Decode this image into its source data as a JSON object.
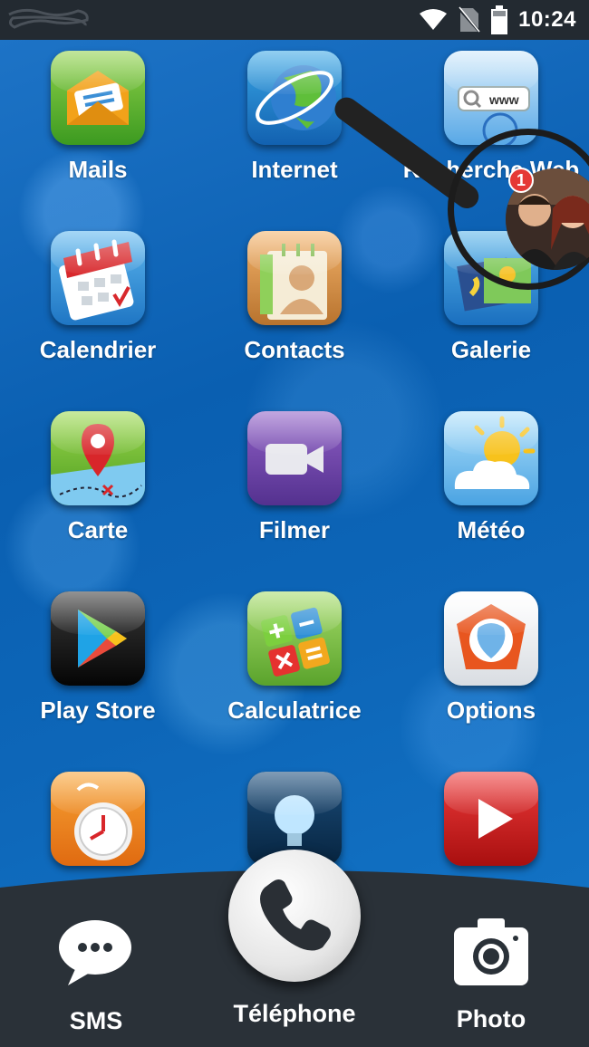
{
  "status_bar": {
    "time": "10:24",
    "icons": [
      "wifi-icon",
      "no-sim-icon",
      "battery-icon"
    ]
  },
  "apps": [
    {
      "label": "Mails",
      "icon": "mail-icon"
    },
    {
      "label": "Internet",
      "icon": "globe-icon"
    },
    {
      "label": "Recherche Web",
      "icon": "web-search-icon"
    },
    {
      "label": "Calendrier",
      "icon": "calendar-icon"
    },
    {
      "label": "Contacts",
      "icon": "contacts-icon"
    },
    {
      "label": "Galerie",
      "icon": "gallery-icon"
    },
    {
      "label": "Carte",
      "icon": "map-icon"
    },
    {
      "label": "Filmer",
      "icon": "video-camera-icon"
    },
    {
      "label": "Météo",
      "icon": "weather-icon"
    },
    {
      "label": "Play Store",
      "icon": "play-store-icon"
    },
    {
      "label": "Calculatrice",
      "icon": "calculator-icon"
    },
    {
      "label": "Options",
      "icon": "options-icon"
    },
    {
      "label": "",
      "icon": "alarm-clock-icon"
    },
    {
      "label": "",
      "icon": "lightbulb-icon"
    },
    {
      "label": "",
      "icon": "youtube-play-icon"
    }
  ],
  "chat_head": {
    "badge_count": "1",
    "icon": "contact-photo-bubble"
  },
  "dock": {
    "sms": {
      "label": "SMS",
      "icon": "chat-bubble-icon"
    },
    "phone": {
      "label": "Téléphone",
      "icon": "phone-handset-icon"
    },
    "photo": {
      "label": "Photo",
      "icon": "camera-icon"
    }
  },
  "colors": {
    "status_bar": "#232a31",
    "wallpaper": "#0b5aa8",
    "dock": "#2a3138",
    "badge": "#e53935"
  }
}
